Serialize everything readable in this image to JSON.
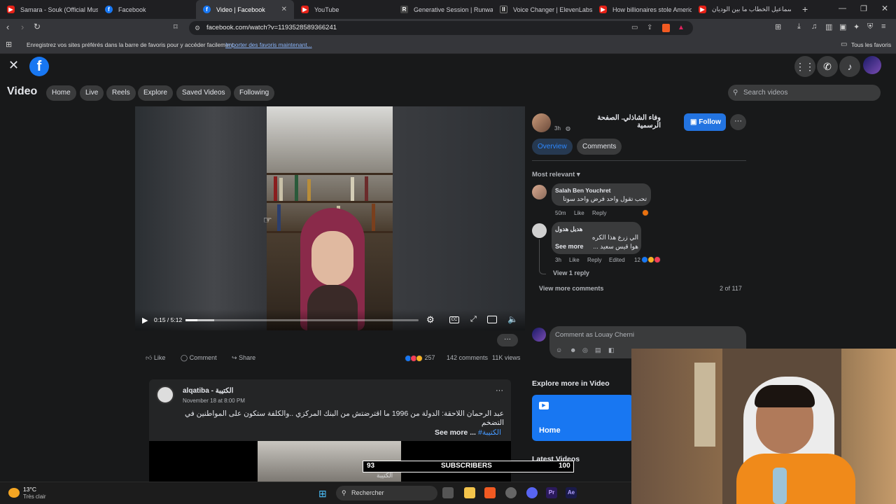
{
  "browser": {
    "tabs": [
      {
        "label": "Samara - Souk (Official Music V",
        "icon": "youtube-icon"
      },
      {
        "label": "Facebook",
        "icon": "facebook-icon"
      },
      {
        "label": "Video | Facebook",
        "icon": "facebook-icon",
        "active": true
      },
      {
        "label": "YouTube",
        "icon": "youtube-icon"
      },
      {
        "label": "Generative Session | Runway AI",
        "icon": "runway-icon"
      },
      {
        "label": "Voice Changer | ElevenLabs",
        "icon": "elevenlabs-icon"
      },
      {
        "label": "How billionaires stole America",
        "icon": "youtube-icon"
      },
      {
        "label": "إسماعيل الخطاب ما بين الوديان",
        "icon": "youtube-icon"
      }
    ],
    "new_tab": "+",
    "url": "facebook.com/watch?v=1193528589366241",
    "bookmarks_text": "Enregistrez vos sites préférés dans la barre de favoris pour y accéder facilement.",
    "bookmarks_link": "Importer des favoris maintenant...",
    "all_bookmarks": "Tous les favoris"
  },
  "fb": {
    "section_title": "Video",
    "nav": [
      "Home",
      "Live",
      "Reels",
      "Explore",
      "Saved Videos",
      "Following"
    ],
    "search_placeholder": "Search videos"
  },
  "player": {
    "time": "0:15 / 5:12",
    "progress": 0.05
  },
  "actions": {
    "like": "Like",
    "comment": "Comment",
    "share": "Share",
    "reaction_count": "257",
    "comments_count": "142 comments",
    "views": "11K views",
    "more": "···"
  },
  "author": {
    "name": "وفاء الشاذلي. الصفحة الرسمية",
    "time": "3h",
    "follow": "Follow",
    "tab_overview": "Overview",
    "tab_comments": "Comments"
  },
  "comments": {
    "sort": "Most relevant",
    "items": [
      {
        "name": "Salah Ben Youchret",
        "text": "تحب تقول واحد فرض واحد سوتا",
        "time": "50m",
        "like": "Like",
        "reply": "Reply"
      },
      {
        "name": "هديل هدول",
        "text1": "الي زرع هذا الكره",
        "text2": "هوا قيس سعيد ...",
        "see_more": "See more",
        "time": "3h",
        "like": "Like",
        "reply": "Reply",
        "edited": "Edited",
        "reacts": "12"
      }
    ],
    "view_reply": "View 1 reply",
    "view_more": "View more comments",
    "count": "2 of 117",
    "input_placeholder": "Comment as Louay Cherni"
  },
  "post": {
    "page": "alqatiba - الكتيبة",
    "date": "November 18 at 8:00 PM",
    "text1": "عبد الرحمان اللاحقة: الدولة من 1996 ما اقترضتش من البنك المركزي ..والكلفة ستكون على المواطنين في",
    "text2": "التضخم",
    "see_more": "See more ...",
    "hashtag": "#الكتيبة"
  },
  "explore": {
    "title": "Explore more in Video",
    "home": "Home",
    "latest": "Latest Videos"
  },
  "overlay": {
    "left": "93",
    "label": "SUBSCRIBERS",
    "right": "100"
  },
  "taskbar": {
    "temp": "13°C",
    "weather": "Très clair",
    "search": "Rechercher"
  }
}
